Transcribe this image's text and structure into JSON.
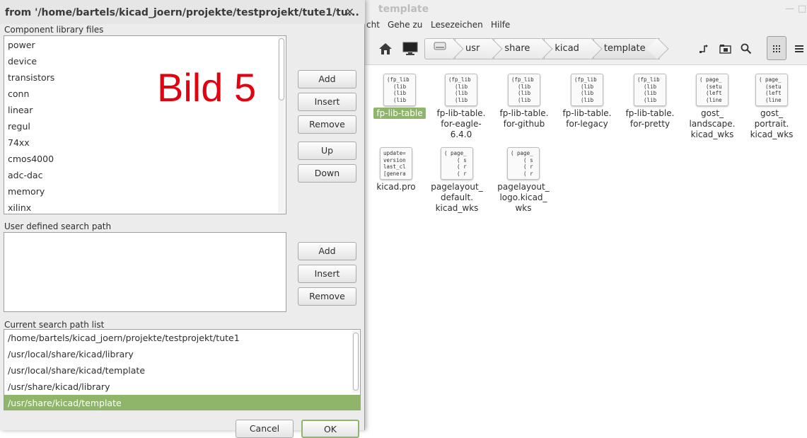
{
  "file_manager": {
    "window_title": "template",
    "menu": [
      "cht",
      "Gehe zu",
      "Lesezeichen",
      "Hilfe"
    ],
    "breadcrumbs": [
      "usr",
      "share",
      "kicad",
      "template"
    ],
    "files_row1": [
      {
        "name": "fp-lib-table",
        "preview": "(fp_lib\n  (lib\n  (lib\n  (lib",
        "selected": true
      },
      {
        "name": "fp-lib-table.\nfor-eagle-\n6.4.0",
        "preview": "(fp_lib\n  (lib\n  (lib\n  (lib",
        "selected": false
      },
      {
        "name": "fp-lib-table.\nfor-github",
        "preview": "(fp_lib\n  (lib\n  (lib\n  (lib",
        "selected": false
      },
      {
        "name": "fp-lib-table.\nfor-legacy",
        "preview": "(fp_lib\n  (lib\n  (lib\n  (lib",
        "selected": false
      },
      {
        "name": "fp-lib-table.\nfor-pretty",
        "preview": "(fp_lib\n  (lib\n  (lib\n  (lib",
        "selected": false
      },
      {
        "name": "gost_\nlandscape.\nkicad_wks",
        "preview": "( page_\n  (setu\n  (left\n  (line",
        "selected": false
      },
      {
        "name": "gost_\nportrait.\nkicad_wks",
        "preview": "( page_\n  (setu\n  (left\n  (line",
        "selected": false
      }
    ],
    "files_row2": [
      {
        "name": "kicad.pro",
        "preview": "update=\nversion\nlast_cl\n[genera",
        "selected": false
      },
      {
        "name": "pagelayout_\ndefault.\nkicad_wks",
        "preview": "( page_\n    ( s\n    ( r\n    ( r",
        "selected": false
      },
      {
        "name": "pagelayout_\nlogo.kicad_\nwks",
        "preview": "( page_\n    ( s\n    ( r\n    ( r",
        "selected": false
      }
    ]
  },
  "dialog": {
    "title": "from '/home/bartels/kicad_joern/projekte/testprojekt/tute1/tu...",
    "overlay_text": "Bild 5",
    "component_library": {
      "label": "Component library files",
      "items": [
        "power",
        "device",
        "transistors",
        "conn",
        "linear",
        "regul",
        "74xx",
        "cmos4000",
        "adc-dac",
        "memory",
        "xilinx"
      ],
      "buttons": {
        "add": "Add",
        "insert": "Insert",
        "remove": "Remove",
        "up": "Up",
        "down": "Down"
      }
    },
    "user_search": {
      "label": "User defined search path",
      "buttons": {
        "add": "Add",
        "insert": "Insert",
        "remove": "Remove"
      }
    },
    "current_search": {
      "label": "Current search path list",
      "items": [
        "/home/bartels/kicad_joern/projekte/testprojekt/tute1",
        "/usr/local/share/kicad/library",
        "/usr/local/share/kicad/template",
        "/usr/share/kicad/library",
        "/usr/share/kicad/template"
      ],
      "selected_index": 4
    },
    "footer": {
      "cancel": "Cancel",
      "ok": "OK"
    }
  },
  "colors": {
    "selection": "#8fb56b",
    "overlay_text": "#e3000f"
  }
}
